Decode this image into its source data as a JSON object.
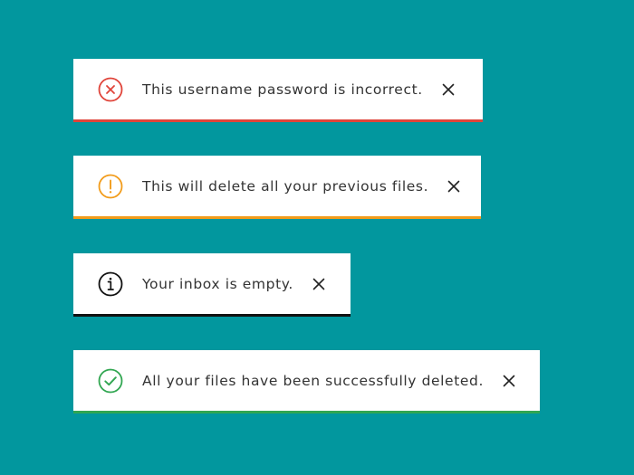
{
  "colors": {
    "background": "#02979e",
    "error": "#e0443a",
    "warning": "#f29c1b",
    "info": "#111111",
    "success": "#31a651"
  },
  "toasts": [
    {
      "type": "error",
      "icon": "error-circle-x-icon",
      "message": "This username password is incorrect."
    },
    {
      "type": "warning",
      "icon": "warning-exclamation-icon",
      "message": "This will delete all your previous files."
    },
    {
      "type": "info",
      "icon": "info-circle-icon",
      "message": "Your inbox is empty."
    },
    {
      "type": "success",
      "icon": "success-check-icon",
      "message": "All your files have been successfully deleted."
    }
  ]
}
